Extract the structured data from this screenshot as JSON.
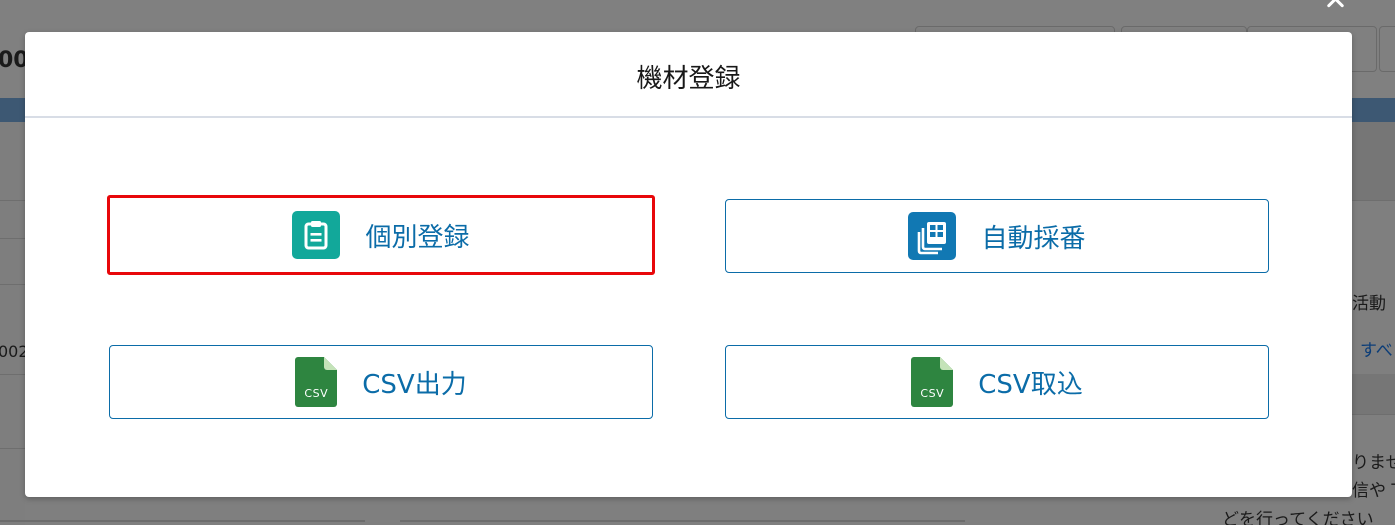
{
  "background": {
    "header_text": "00",
    "side_text_1": "活動",
    "side_link": "すべ",
    "side_text_2": "りませ",
    "side_text_3": "信や T",
    "side_text_4": "どを行ってください",
    "left_id": "002"
  },
  "modal": {
    "title": "機材登録",
    "buttons": {
      "individual": {
        "label": "個別登録",
        "icon": "clipboard-icon"
      },
      "auto_number": {
        "label": "自動採番",
        "icon": "stacked-records-icon"
      },
      "csv_export": {
        "label": "CSV出力",
        "icon": "csv-file-icon",
        "icon_text": "CSV"
      },
      "csv_import": {
        "label": "CSV取込",
        "icon": "csv-file-icon",
        "icon_text": "CSV"
      }
    }
  },
  "colors": {
    "accent": "#0b6ca8",
    "highlight": "#e8070a",
    "clipboard_icon_bg": "#12a89a",
    "records_icon_bg": "#1178b3",
    "csv_icon_bg": "#2e8540"
  }
}
